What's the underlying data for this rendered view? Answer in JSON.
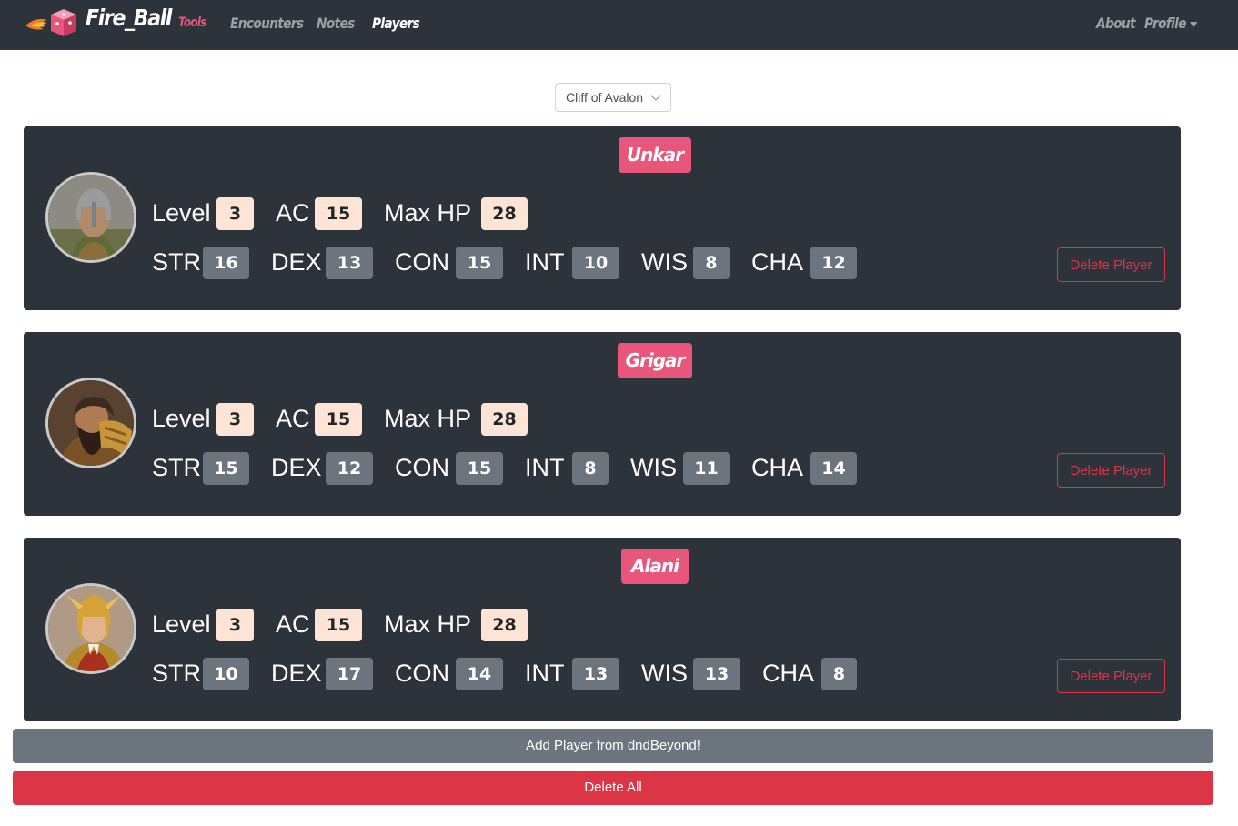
{
  "navbar": {
    "brand_name": "Fire_Ball",
    "brand_sub": "Tools",
    "links": [
      {
        "label": "Encounters",
        "active": false
      },
      {
        "label": "Notes",
        "active": false
      },
      {
        "label": "Players",
        "active": true
      }
    ],
    "right_links": [
      {
        "label": "About"
      },
      {
        "label": "Profile"
      }
    ]
  },
  "campaign_select": {
    "selected": "Cliff of Avalon"
  },
  "stat_labels": {
    "level": "Level",
    "ac": "AC",
    "max_hp": "Max HP",
    "str": "STR",
    "dex": "DEX",
    "con": "CON",
    "int": "INT",
    "wis": "WIS",
    "cha": "CHA"
  },
  "players": [
    {
      "name": "Unkar",
      "level": "3",
      "ac": "15",
      "max_hp": "28",
      "str": "16",
      "dex": "13",
      "con": "15",
      "int": "10",
      "wis": "8",
      "cha": "12",
      "delete_label": "Delete Player"
    },
    {
      "name": "Grigar",
      "level": "3",
      "ac": "15",
      "max_hp": "28",
      "str": "15",
      "dex": "12",
      "con": "15",
      "int": "8",
      "wis": "11",
      "cha": "14",
      "delete_label": "Delete Player"
    },
    {
      "name": "Alani",
      "level": "3",
      "ac": "15",
      "max_hp": "28",
      "str": "10",
      "dex": "17",
      "con": "14",
      "int": "13",
      "wis": "13",
      "cha": "8",
      "delete_label": "Delete Player"
    }
  ],
  "actions": {
    "add_player_label": "Add Player from dndBeyond!",
    "delete_all_label": "Delete All"
  },
  "colors": {
    "navbar_bg": "#2d333b",
    "accent_pink": "#e8567a",
    "danger": "#dc3545",
    "secondary": "#6c757d",
    "badge_light": "#fde4d4"
  },
  "icons": {
    "brand": "fireball-dice-logo",
    "profile_caret": "caret-down-icon",
    "select_chevron": "chevron-down-icon"
  }
}
